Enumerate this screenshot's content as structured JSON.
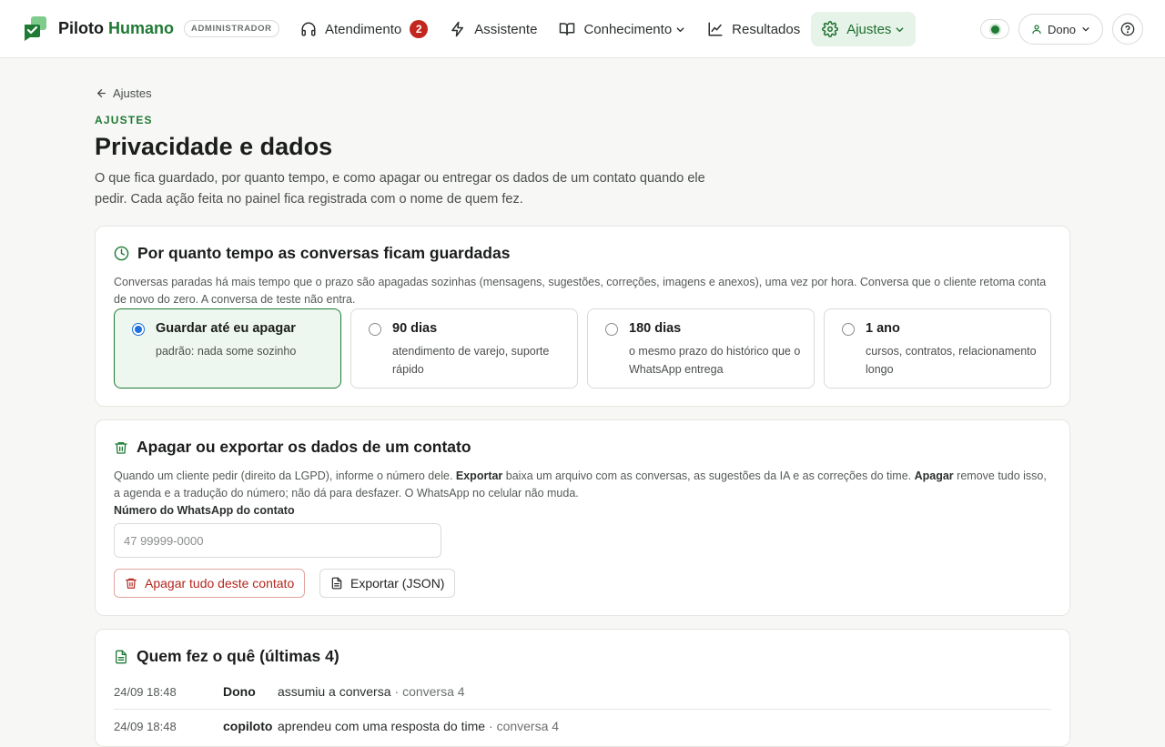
{
  "app": {
    "brand_first": "Piloto",
    "brand_second": "Humano",
    "role_badge": "ADMINISTRADOR",
    "brand_color": "#1f7a34"
  },
  "nav": [
    {
      "label": "Atendimento",
      "icon": "headset-icon",
      "badge": "2"
    },
    {
      "label": "Assistente",
      "icon": "lightning-icon"
    },
    {
      "label": "Conhecimento",
      "icon": "book-icon",
      "has_menu": true
    },
    {
      "label": "Resultados",
      "icon": "chart-line-icon"
    },
    {
      "label": "Ajustes",
      "icon": "gear-icon",
      "has_menu": true,
      "active": true
    }
  ],
  "header_right": {
    "online_status": "on",
    "user_label": "Dono"
  },
  "page": {
    "back_label": "Ajustes",
    "eyebrow": "AJUSTES",
    "title": "Privacidade e dados",
    "description": "O que fica guardado, por quanto tempo, e como apagar ou entregar os dados de um contato quando ele pedir. Cada ação feita no painel fica registrada com o nome de quem fez."
  },
  "retention": {
    "title": "Por quanto tempo as conversas ficam guardadas",
    "text": "Conversas paradas há mais tempo que o prazo são apagadas sozinhas (mensagens, sugestões, correções, imagens e anexos), uma vez por hora. Conversa que o cliente retoma conta de novo do zero. A conversa de teste não entra.",
    "options": [
      {
        "title": "Guardar até eu apagar",
        "subtitle": "padrão: nada some sozinho",
        "selected": true
      },
      {
        "title": "90 dias",
        "subtitle": "atendimento de varejo, suporte rápido",
        "selected": false
      },
      {
        "title": "180 dias",
        "subtitle": "o mesmo prazo do histórico que o WhatsApp entrega",
        "selected": false
      },
      {
        "title": "1 ano",
        "subtitle": "cursos, contratos, relacionamento longo",
        "selected": false
      }
    ]
  },
  "contact_data": {
    "title": "Apagar ou exportar os dados de um contato",
    "text_intro": "Quando um cliente pedir (direito da LGPD), informe o número dele. ",
    "text_export_bold": "Exportar",
    "text_export": " baixa um arquivo com as conversas, as sugestões da IA e as correções do time. ",
    "text_delete_bold": "Apagar",
    "text_delete": " remove tudo isso, a agenda e a tradução do número; não dá para desfazer. O WhatsApp no celular não muda.",
    "field_label": "Número do WhatsApp do contato",
    "field_placeholder": "47 99999-0000",
    "field_value": "",
    "delete_button": "Apagar tudo deste contato",
    "export_button": "Exportar (JSON)"
  },
  "audit_log": {
    "title": "Quem fez o quê (últimas 4)",
    "rows": [
      {
        "time": "24/09 18:48",
        "who": "Dono",
        "what": "assumiu a conversa",
        "context": "· conversa 4"
      },
      {
        "time": "24/09 18:48",
        "who": "copiloto",
        "what": "aprendeu com uma resposta do time",
        "context": "· conversa 4"
      }
    ]
  }
}
